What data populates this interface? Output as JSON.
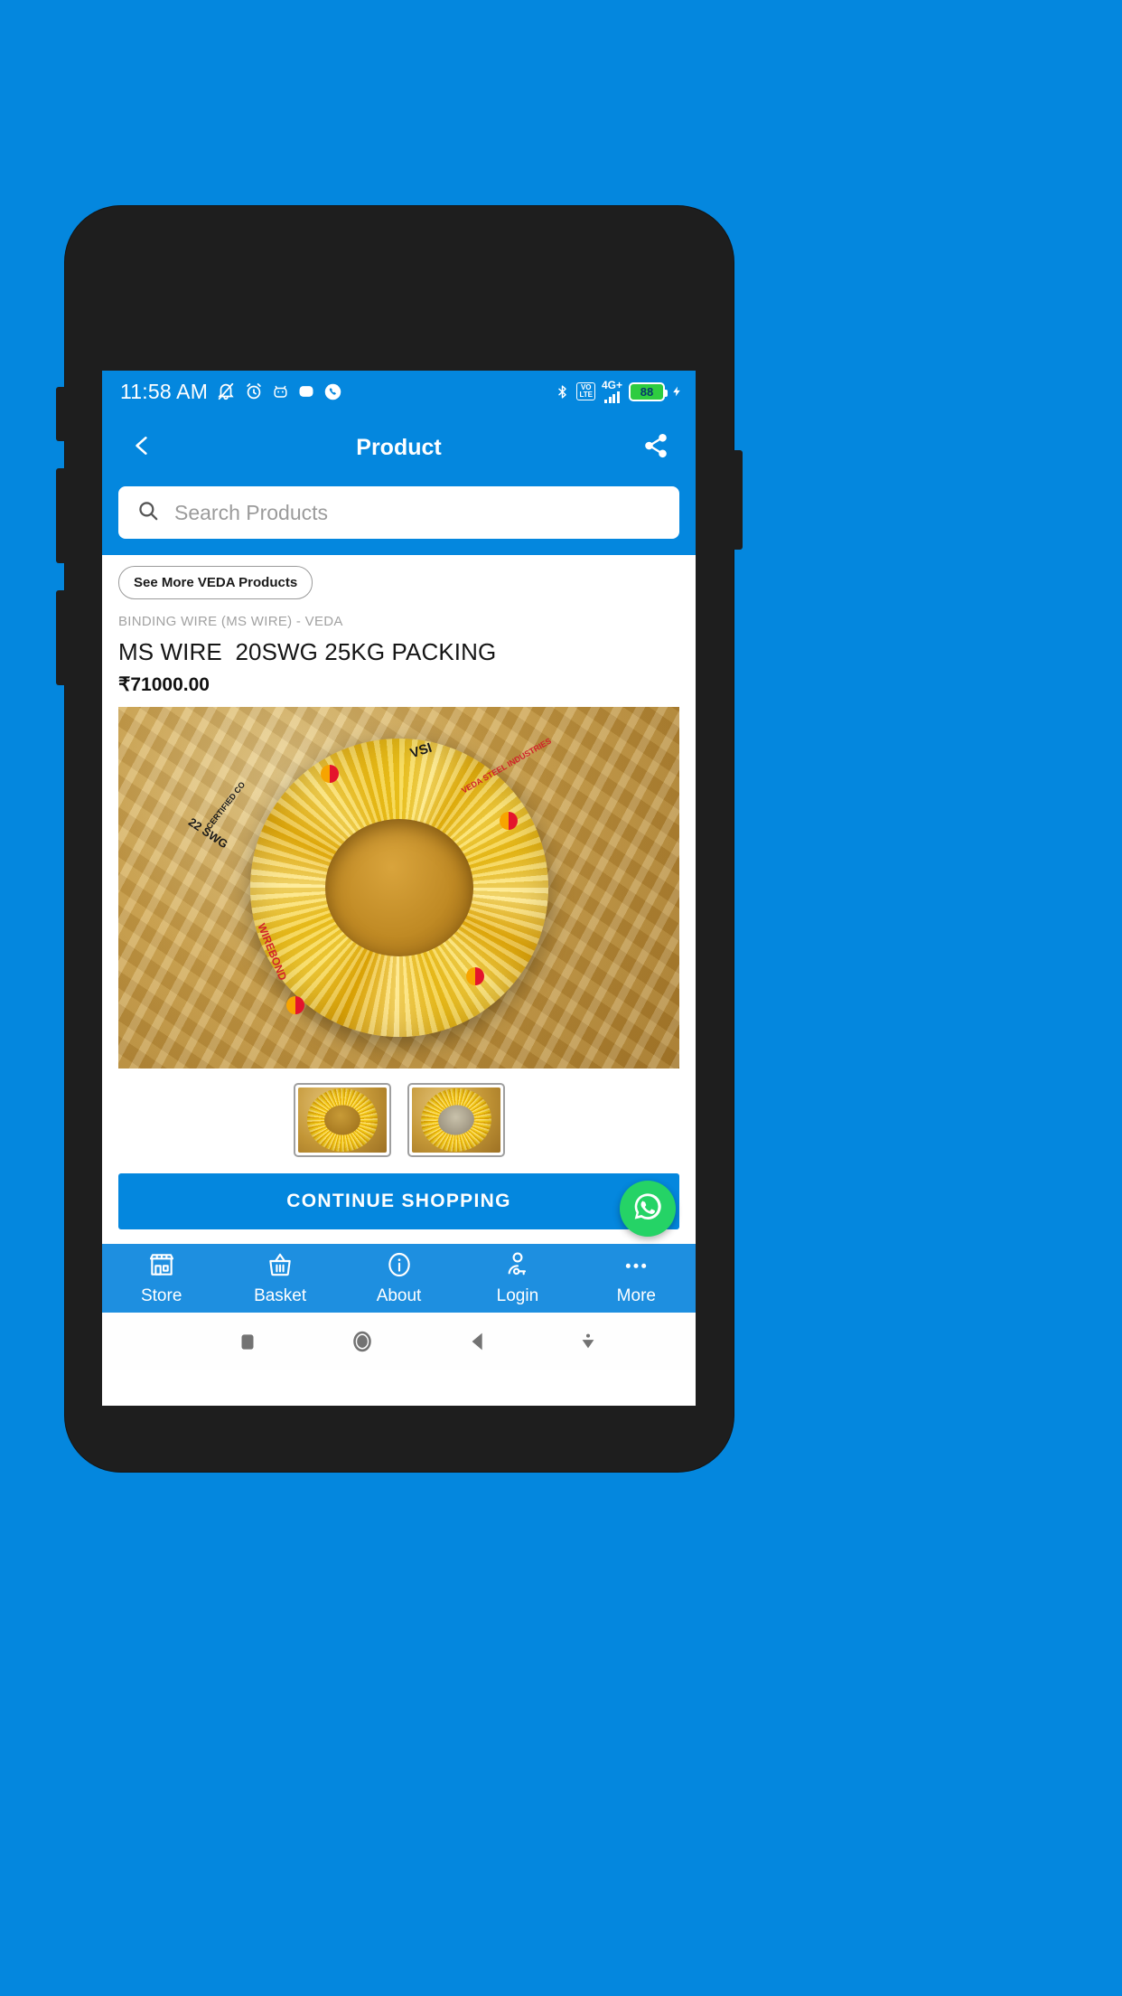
{
  "background_color": "#0487de",
  "accent_color": "#0487de",
  "statusbar": {
    "time": "11:58 AM",
    "battery_percent": "88",
    "network_label": "4G+",
    "volte_top": "VO",
    "volte_bottom": "LTE",
    "icons": [
      "mute-bell-icon",
      "alarm-clock-icon",
      "android-head-icon",
      "rounded-square-icon",
      "phone-circle-icon",
      "bluetooth-icon",
      "volte-icon",
      "signal-bars-icon",
      "battery-icon",
      "charging-bolt-icon"
    ]
  },
  "appbar": {
    "title": "Product",
    "back_icon": "chevron-left-icon",
    "share_icon": "share-icon"
  },
  "search": {
    "placeholder": "Search Products",
    "value": "",
    "icon": "search-icon"
  },
  "product": {
    "see_more_label": "See More VEDA Products",
    "category": "BINDING WIRE (MS WIRE) - VEDA",
    "title": "MS WIRE  20SWG 25KG PACKING",
    "price": "₹71000.00",
    "image_alt": "yellow-wrapped-ms-wire-coil",
    "image_marks": {
      "brand_short": "VSI",
      "brand_full": "VEDA STEEL INDUSTRIES",
      "wire_brand": "WIREBOND",
      "certification": "CERTIFIED CO",
      "gauge_tape": "22 SWG"
    },
    "thumbnails": [
      {
        "alt": "wire-coil-front-view"
      },
      {
        "alt": "wire-coil-angled-view"
      }
    ]
  },
  "cta": {
    "label": "CONTINUE SHOPPING",
    "whatsapp_icon": "whatsapp-icon"
  },
  "tabbar": {
    "items": [
      {
        "label": "Store",
        "icon": "store-icon"
      },
      {
        "label": "Basket",
        "icon": "basket-icon"
      },
      {
        "label": "About",
        "icon": "info-circle-icon"
      },
      {
        "label": "Login",
        "icon": "user-key-icon"
      },
      {
        "label": "More",
        "icon": "ellipsis-icon"
      }
    ]
  },
  "androidnav": {
    "items": [
      {
        "icon": "recents-square-icon"
      },
      {
        "icon": "home-circle-icon"
      },
      {
        "icon": "back-triangle-icon"
      },
      {
        "icon": "hide-nav-arrow-icon"
      }
    ]
  }
}
